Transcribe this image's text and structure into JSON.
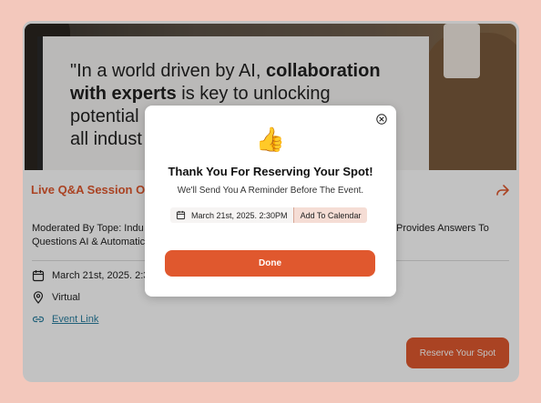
{
  "hero": {
    "quote_text_1": "\"In a world driven by AI, ",
    "quote_bold_1": "collaboration",
    "quote_bold_2": "with experts",
    "quote_text_2": " is key to unlocking",
    "quote_line_3": "potential",
    "quote_line_4": "all indust"
  },
  "event": {
    "title": "Live Q&A Session On A",
    "description_left_1": "Moderated By Tope: Indu",
    "description_right_1": "Provides Answers To",
    "description_line_2": "Questions AI & Automatic",
    "date": "March 21st, 2025. 2:3",
    "venue": "Virtual",
    "event_link_label": "Event Link",
    "reserve_button": "Reserve Your Spot"
  },
  "modal": {
    "title": "Thank You For Reserving Your Spot!",
    "subtitle": "We'll Send You A Reminder Before The Event.",
    "date_time": "March 21st, 2025. 2:30PM",
    "add_to_calendar": "Add To Calendar",
    "done_button": "Done",
    "thumb_emoji": "👍"
  },
  "icons": {
    "close": "close-icon",
    "share": "share-icon",
    "calendar": "calendar-icon",
    "location": "location-pin-icon",
    "link": "link-icon",
    "thumbs_up": "thumbs-up-icon"
  },
  "colors": {
    "accent": "#e0582e",
    "page_bg": "#f3c8bc",
    "link": "#2a7fa0"
  }
}
